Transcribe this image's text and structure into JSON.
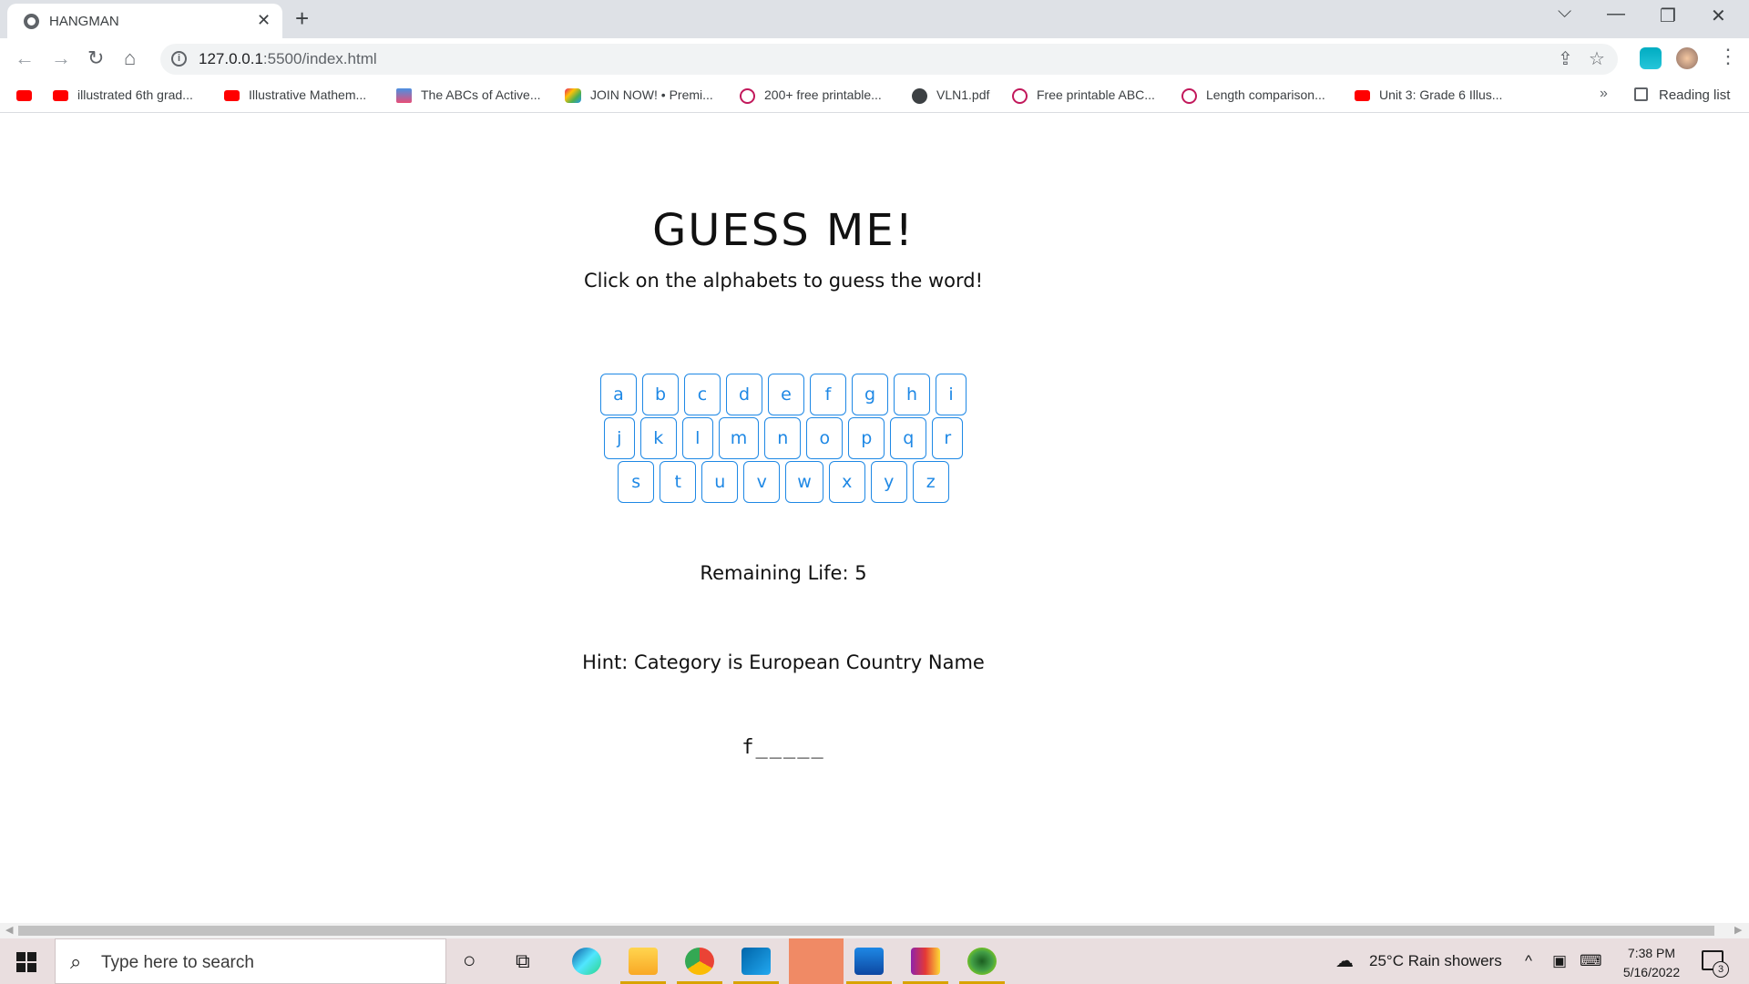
{
  "browser": {
    "tab_title": "HANGMAN",
    "tab_close": "✕",
    "new_tab": "+",
    "url_host": "127.0.0.1",
    "url_path": ":5500/index.html",
    "window_controls": {
      "chevron": "⌵",
      "minimize": "—",
      "restore": "❐",
      "close": "✕"
    }
  },
  "bookmarks": [
    {
      "label": "",
      "icon": "youtube-icon"
    },
    {
      "label": "illustrated 6th grad...",
      "icon": "youtube-icon"
    },
    {
      "label": "Illustrative Mathem...",
      "icon": "youtube-icon"
    },
    {
      "label": "The ABCs of Active...",
      "icon": "abc-icon"
    },
    {
      "label": "JOIN NOW! • Premi...",
      "icon": "colorful-icon"
    },
    {
      "label": "200+ free printable...",
      "icon": "circle-icon"
    },
    {
      "label": "VLN1.pdf",
      "icon": "globe-icon"
    },
    {
      "label": "Free printable ABC...",
      "icon": "circle-icon"
    },
    {
      "label": "Length comparison...",
      "icon": "circle-icon"
    },
    {
      "label": "Unit 3: Grade 6 Illus...",
      "icon": "youtube-icon"
    }
  ],
  "bookmarks_more": "»",
  "reading_list": "Reading list",
  "game": {
    "title": "GUESS ME!",
    "subtitle": "Click on the alphabets to guess the word!",
    "rows": [
      [
        "a",
        "b",
        "c",
        "d",
        "e",
        "f",
        "g",
        "h",
        "i"
      ],
      [
        "j",
        "k",
        "l",
        "m",
        "n",
        "o",
        "p",
        "q",
        "r"
      ],
      [
        "s",
        "t",
        "u",
        "v",
        "w",
        "x",
        "y",
        "z"
      ]
    ],
    "remaining_life": "Remaining Life: 5",
    "hint": "Hint: Category is European Country Name",
    "word": "f_____"
  },
  "taskbar": {
    "search_placeholder": "Type here to search",
    "weather": "25°C  Rain showers",
    "time": "7:38 PM",
    "date": "5/16/2022",
    "notification_count": "3"
  },
  "colors": {
    "accent": "#1e88e5",
    "tab_strip": "#dee1e6",
    "taskbar": "#e9dedf"
  }
}
